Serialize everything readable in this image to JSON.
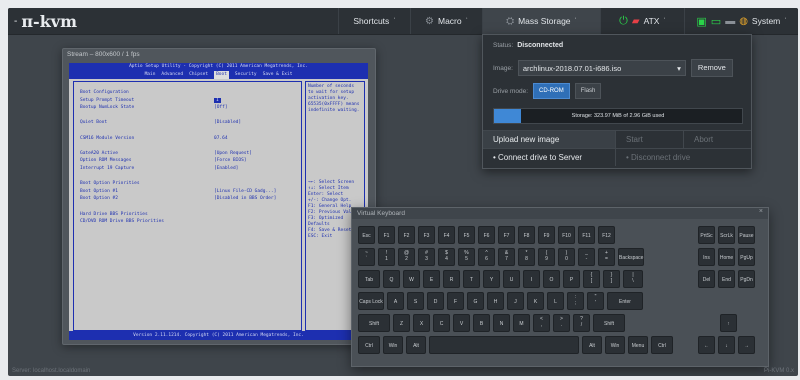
{
  "brand": {
    "dash": "-",
    "logo": "π-kvm"
  },
  "menu": {
    "shortcuts": "Shortcuts",
    "macro": "Macro",
    "mass_storage": "Mass Storage",
    "atx": "ATX",
    "system": "System",
    "chevron": "ʾ"
  },
  "stream": {
    "title": "Stream – 800x600 / 1 fps",
    "bios": {
      "header": "Aptio Setup Utility - Copyright (C) 2011 American Megatrends, Inc.",
      "tabs": [
        "Main",
        "Advanced",
        "Chipset",
        "Boot",
        "Security",
        "Save & Exit"
      ],
      "selected_tab": "Boot",
      "lines": [
        {
          "label": "Boot Configuration",
          "value": ""
        },
        {
          "label": "Setup Prompt Timeout",
          "value": "1",
          "selected": true
        },
        {
          "label": "Bootup NumLock State",
          "value": "[Off]"
        },
        {
          "label": "",
          "value": ""
        },
        {
          "label": "Quiet Boot",
          "value": "[Disabled]"
        },
        {
          "label": "",
          "value": ""
        },
        {
          "label": "CSM16 Module Version",
          "value": "07.64"
        },
        {
          "label": "",
          "value": ""
        },
        {
          "label": "GateA20 Active",
          "value": "[Upon Request]"
        },
        {
          "label": "Option ROM Messages",
          "value": "[Force BIOS]"
        },
        {
          "label": "Interrupt 19 Capture",
          "value": "[Enabled]"
        },
        {
          "label": "",
          "value": ""
        },
        {
          "label": "Boot Option Priorities",
          "value": ""
        },
        {
          "label": "Boot Option #1",
          "value": "[Linux File-CD Gadg...]"
        },
        {
          "label": "Boot Option #2",
          "value": "[Disabled in BBS Order]"
        },
        {
          "label": "",
          "value": ""
        },
        {
          "label": "Hard Drive BBS Priorities",
          "value": ""
        },
        {
          "label": "CD/DVD ROM Drive BBS Priorities",
          "value": ""
        }
      ],
      "help": "Number of seconds to wait for setup activation key. 65535(0xFFFF) means indefinite waiting.",
      "keys": [
        "→←: Select Screen",
        "↑↓: Select Item",
        "Enter: Select",
        "+/-: Change Opt.",
        "F1: General Help",
        "F2: Previous Values",
        "F3: Optimized Defaults",
        "F4: Save & Reset",
        "ESC: Exit"
      ],
      "footer": "Version 2.11.1214. Copyright (C) 2011 American Megatrends, Inc."
    }
  },
  "mass_storage": {
    "status_label": "Status:",
    "status_value": "Disconnected",
    "image_label": "Image:",
    "image_value": "archlinux-2018.07.01-i686.iso",
    "remove_label": "Remove",
    "drive_mode_label": "Drive mode:",
    "mode_cdrom": "CD-ROM",
    "mode_flash": "Flash",
    "storage_text": "Storage: 323.97 MiB of 2.96 GiB used",
    "storage_used_fraction": 0.107,
    "upload_label": "Upload new image",
    "start_label": "Start",
    "abort_label": "Abort",
    "connect_label": "• Connect drive to Server",
    "disconnect_label": "• Disconnect drive"
  },
  "keyboard": {
    "title": "Virtual Keyboard",
    "close": "×",
    "rows": [
      [
        "Esc",
        "F1",
        "F2",
        "F3",
        "F4",
        "F5",
        "F6",
        "F7",
        "F8",
        "F9",
        "F10",
        "F11",
        "F12",
        "PrtSc",
        "ScrLk",
        "Pause"
      ],
      [
        "~ `",
        "! 1",
        "@ 2",
        "# 3",
        "$ 4",
        "% 5",
        "^ 6",
        "& 7",
        "* 8",
        "( 9",
        ") 0",
        "_ -",
        "+ =",
        "Backspace",
        "Ins",
        "Home",
        "PgUp"
      ],
      [
        "Tab",
        "Q",
        "W",
        "E",
        "R",
        "T",
        "Y",
        "U",
        "I",
        "O",
        "P",
        "{ [",
        "} ]",
        "| \\",
        "Del",
        "End",
        "PgDn"
      ],
      [
        "Caps Lock",
        "A",
        "S",
        "D",
        "F",
        "G",
        "H",
        "J",
        "K",
        "L",
        ": ;",
        "\" '",
        "Enter"
      ],
      [
        "Shift",
        "Z",
        "X",
        "C",
        "V",
        "B",
        "N",
        "M",
        "< ,",
        "> .",
        "? /",
        "Shift",
        "↑"
      ],
      [
        "Ctrl",
        "Win",
        "Alt",
        "",
        "Alt",
        "Win",
        "Menu",
        "Ctrl",
        "←",
        "↓",
        "→"
      ]
    ]
  },
  "footer": {
    "left": "Server: localhost.localdomain",
    "right": "Pi-KVM 0.x"
  }
}
